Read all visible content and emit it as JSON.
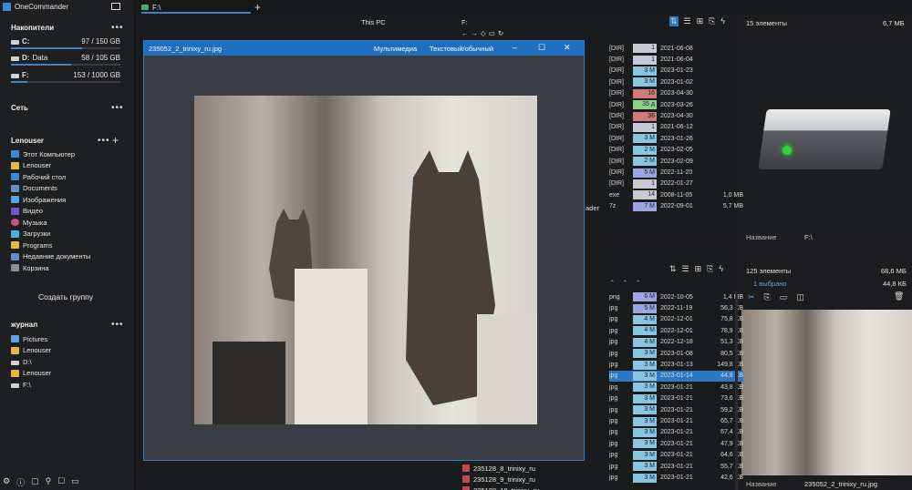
{
  "app": {
    "title": "OneCommander"
  },
  "sidebar": {
    "drives_header": "Накопители",
    "drives": [
      {
        "name": "C:",
        "label": "",
        "space": "97 / 150 GB",
        "fill": 0.65
      },
      {
        "name": "D:",
        "label": "Data",
        "space": "58 / 105 GB",
        "fill": 0.55
      },
      {
        "name": "F:",
        "label": "",
        "space": "153 / 1000 GB",
        "fill": 0.15
      }
    ],
    "network_header": "Сеть",
    "user_header": "Lenouser",
    "user_items": [
      {
        "icon": "computer-icon",
        "label": "Этот Компьютер"
      },
      {
        "icon": "folder-icon",
        "label": "Lenouser"
      },
      {
        "icon": "desktop-icon",
        "label": "Рабочий стол"
      },
      {
        "icon": "documents-icon",
        "label": "Documents"
      },
      {
        "icon": "images-icon",
        "label": "Изображения"
      },
      {
        "icon": "video-icon",
        "label": "Видео"
      },
      {
        "icon": "music-icon",
        "label": "Музыка"
      },
      {
        "icon": "downloads-icon",
        "label": "Загрузки"
      },
      {
        "icon": "programs-icon",
        "label": "Programs"
      },
      {
        "icon": "recent-icon",
        "label": "Недавние документы"
      },
      {
        "icon": "trash-icon",
        "label": "Корзина"
      }
    ],
    "create_group": "Создать группу",
    "journal_header": "журнал",
    "journal_items": [
      {
        "icon": "images-icon",
        "label": "Pictures"
      },
      {
        "icon": "folder-icon",
        "label": "Lenouser"
      },
      {
        "icon": "drive-icon",
        "label": "D:\\"
      },
      {
        "icon": "folder-icon",
        "label": "Lenouser"
      },
      {
        "icon": "drive-icon",
        "label": "F:\\"
      }
    ],
    "bottom_icons": [
      "⚙",
      "ⓘ",
      "▢",
      "⚲",
      "☐",
      "▭"
    ]
  },
  "top_tab": {
    "label": "F:\\",
    "add": "+"
  },
  "pane_headers": {
    "this_pc": "This PC",
    "f_drive": "F:"
  },
  "top_right": {
    "count": "15 элементы",
    "size": "6,7 МБ",
    "name_label": "Название",
    "name_value": "F:\\"
  },
  "top_rows": [
    {
      "ext": "[DIR]",
      "cnt": "1",
      "color": "#c8c9d4",
      "date": "2021-06-08",
      "size": ""
    },
    {
      "ext": "[DIR]",
      "cnt": "1",
      "color": "#c8c9d4",
      "date": "2021-06-04",
      "size": ""
    },
    {
      "ext": "[DIR]",
      "cnt": "3 M",
      "color": "#8ac4e0",
      "date": "2023-01-23",
      "size": ""
    },
    {
      "ext": "[DIR]",
      "cnt": "3 M",
      "color": "#8ac4e0",
      "date": "2023-01-02",
      "size": ""
    },
    {
      "ext": "[DIR]",
      "cnt": "16",
      "color": "#d07a7a",
      "date": "2023-04-30",
      "size": ""
    },
    {
      "ext": "[DIR]",
      "cnt": "35 д",
      "color": "#8ed08a",
      "date": "2023-03-26",
      "size": ""
    },
    {
      "ext": "[DIR]",
      "cnt": "36",
      "color": "#d07a7a",
      "date": "2023-04-30",
      "size": ""
    },
    {
      "ext": "[DIR]",
      "cnt": "1",
      "color": "#c8c9d4",
      "date": "2021-06-12",
      "size": ""
    },
    {
      "ext": "[DIR]",
      "cnt": "3 M",
      "color": "#8ac4e0",
      "date": "2023-01-26",
      "size": ""
    },
    {
      "ext": "[DIR]",
      "cnt": "2 M",
      "color": "#8ac4e0",
      "date": "2023-02-05",
      "size": ""
    },
    {
      "ext": "[DIR]",
      "cnt": "2 M",
      "color": "#8ac4e0",
      "date": "2023-02-09",
      "size": ""
    },
    {
      "ext": "[DIR]",
      "cnt": "5 M",
      "color": "#9ba6e0",
      "date": "2022-11-20",
      "size": ""
    },
    {
      "ext": "[DIR]",
      "cnt": "1",
      "color": "#c8c9d4",
      "date": "2022-01-27",
      "size": ""
    },
    {
      "ext": "exe",
      "cnt": "14",
      "color": "#c8c9d4",
      "date": "2008-11-05",
      "size": "1,0 MB"
    },
    {
      "ext": "7z",
      "cnt": "7 M",
      "color": "#9ba6e0",
      "date": "2022-09-01",
      "size": "5,7 MB"
    }
  ],
  "top_left_fragment": "ader",
  "bottom_right": {
    "count": "125 элементы",
    "size": "68,6 МБ",
    "selected": "1 выбрано",
    "sel_size": "44,8 КБ",
    "name_label": "Название",
    "name_value": "235052_2_trinixy_ru.jpg"
  },
  "bottom_rows": [
    {
      "ext": "png",
      "cnt": "6 M",
      "color": "#9ba6e0",
      "date": "2022-10-05",
      "size": "1,4 MB",
      "selected": false
    },
    {
      "ext": "jpg",
      "cnt": "5 M",
      "color": "#9ba6e0",
      "date": "2022-11-19",
      "size": "56,3 KB",
      "selected": false
    },
    {
      "ext": "jpg",
      "cnt": "4 M",
      "color": "#8ac4e0",
      "date": "2022-12-01",
      "size": "75,8 KB",
      "selected": false
    },
    {
      "ext": "jpg",
      "cnt": "4 M",
      "color": "#8ac4e0",
      "date": "2022-12-01",
      "size": "78,9 KB",
      "selected": false
    },
    {
      "ext": "jpg",
      "cnt": "4 M",
      "color": "#8ac4e0",
      "date": "2022-12-18",
      "size": "51,3 KB",
      "selected": false
    },
    {
      "ext": "jpg",
      "cnt": "3 M",
      "color": "#8ac4e0",
      "date": "2023-01-08",
      "size": "80,5 KB",
      "selected": false
    },
    {
      "ext": "jpg",
      "cnt": "3 M",
      "color": "#8ac4e0",
      "date": "2023-01-13",
      "size": "149,8 KB",
      "selected": false
    },
    {
      "ext": "jpg",
      "cnt": "3 M",
      "color": "#8ac4e0",
      "date": "2023-01-14",
      "size": "44,8 KB",
      "selected": true
    },
    {
      "ext": "jpg",
      "cnt": "3 M",
      "color": "#8ac4e0",
      "date": "2023-01-21",
      "size": "43,8 KB",
      "selected": false
    },
    {
      "ext": "jpg",
      "cnt": "3 M",
      "color": "#8ac4e0",
      "date": "2023-01-21",
      "size": "73,6 KB",
      "selected": false
    },
    {
      "ext": "jpg",
      "cnt": "3 M",
      "color": "#8ac4e0",
      "date": "2023-01-21",
      "size": "59,2 KB",
      "selected": false
    },
    {
      "ext": "jpg",
      "cnt": "3 M",
      "color": "#8ac4e0",
      "date": "2023-01-21",
      "size": "65,7 KB",
      "selected": false
    },
    {
      "ext": "jpg",
      "cnt": "3 M",
      "color": "#8ac4e0",
      "date": "2023-01-21",
      "size": "67,4 KB",
      "selected": false
    },
    {
      "ext": "jpg",
      "cnt": "3 M",
      "color": "#8ac4e0",
      "date": "2023-01-21",
      "size": "47,9 KB",
      "selected": false
    },
    {
      "ext": "jpg",
      "cnt": "3 M",
      "color": "#8ac4e0",
      "date": "2023-01-21",
      "size": "64,6 KB",
      "selected": false
    },
    {
      "ext": "jpg",
      "cnt": "3 M",
      "color": "#8ac4e0",
      "date": "2023-01-21",
      "size": "55,7 KB",
      "selected": false
    },
    {
      "ext": "jpg",
      "cnt": "3 M",
      "color": "#8ac4e0",
      "date": "2023-01-21",
      "size": "42,6 KB",
      "selected": false
    }
  ],
  "bottom_filenames": [
    "235128_8_trinixy_ru",
    "235128_9_trinixy_ru",
    "235128_10_trinixy_ru"
  ],
  "viewer": {
    "title": "235052_2_trinixy_ru.jpg",
    "menu_media": "Мультимедиа",
    "menu_text": "Текстовый/обычный",
    "min": "–",
    "max": "☐",
    "close": "✕"
  },
  "colors": {
    "accent": "#1f6fc0",
    "selection": "#2a79c2"
  }
}
